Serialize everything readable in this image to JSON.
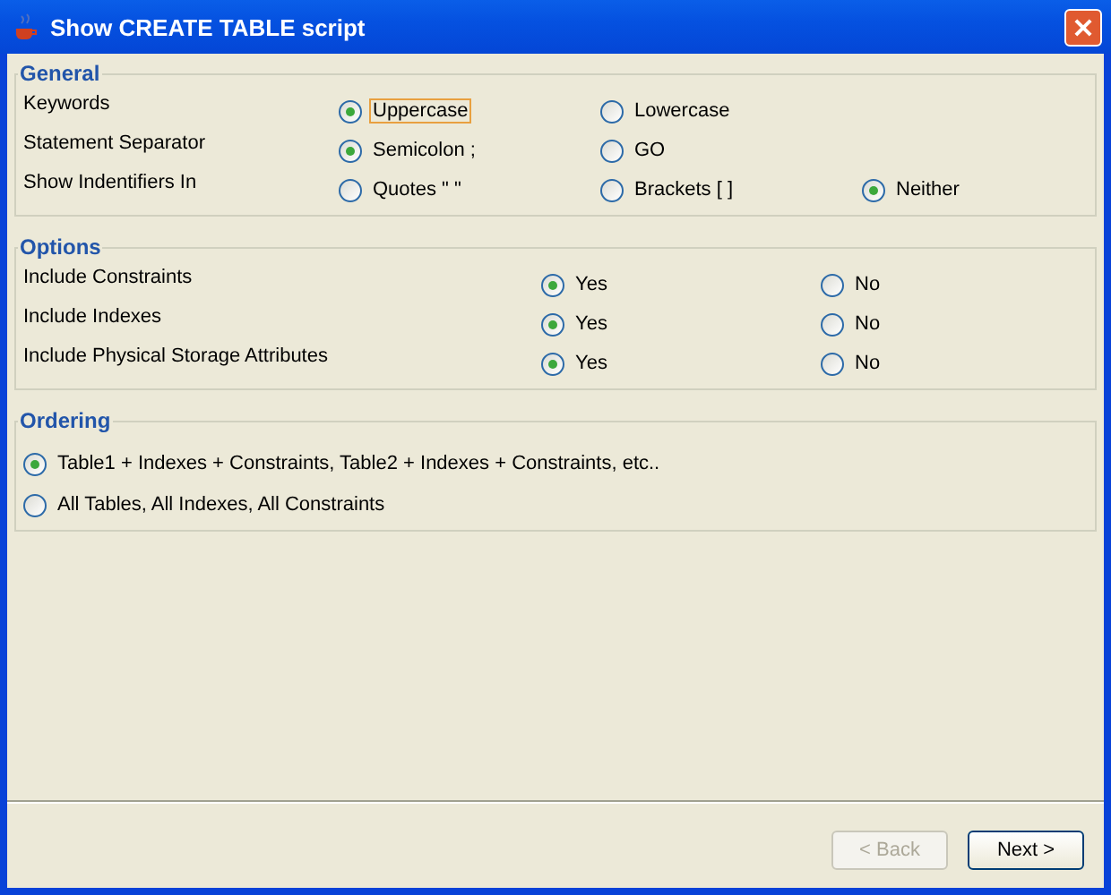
{
  "window": {
    "title": "Show CREATE TABLE script"
  },
  "sections": [
    {
      "title": "General",
      "kind": "grid3",
      "rows": [
        {
          "label": "Keywords",
          "options": [
            {
              "label": "Uppercase",
              "selected": true,
              "focused": true
            },
            {
              "label": "Lowercase",
              "selected": false,
              "focused": false
            }
          ]
        },
        {
          "label": "Statement Separator",
          "options": [
            {
              "label": "Semicolon ;",
              "selected": true,
              "focused": false
            },
            {
              "label": "GO",
              "selected": false,
              "focused": false
            }
          ]
        },
        {
          "label": "Show Indentifiers In",
          "options": [
            {
              "label": "Quotes \" \"",
              "selected": false,
              "focused": false
            },
            {
              "label": "Brackets [ ]",
              "selected": false,
              "focused": false
            },
            {
              "label": "Neither",
              "selected": true,
              "focused": false
            }
          ]
        }
      ]
    },
    {
      "title": "Options",
      "kind": "grid2",
      "rows": [
        {
          "label": "Include Constraints",
          "options": [
            {
              "label": "Yes",
              "selected": true,
              "focused": false
            },
            {
              "label": "No",
              "selected": false,
              "focused": false
            }
          ]
        },
        {
          "label": "Include Indexes",
          "options": [
            {
              "label": "Yes",
              "selected": true,
              "focused": false
            },
            {
              "label": "No",
              "selected": false,
              "focused": false
            }
          ]
        },
        {
          "label": "Include Physical Storage Attributes",
          "options": [
            {
              "label": "Yes",
              "selected": true,
              "focused": false
            },
            {
              "label": "No",
              "selected": false,
              "focused": false
            }
          ]
        }
      ]
    },
    {
      "title": "Ordering",
      "kind": "stack",
      "options": [
        {
          "label": "Table1 + Indexes + Constraints, Table2 + Indexes + Constraints, etc..",
          "selected": true,
          "focused": false
        },
        {
          "label": "All Tables, All Indexes, All Constraints",
          "selected": false,
          "focused": false
        }
      ]
    }
  ],
  "buttons": [
    {
      "label": "< Back",
      "disabled": true
    },
    {
      "label": "Next >",
      "disabled": false
    }
  ]
}
